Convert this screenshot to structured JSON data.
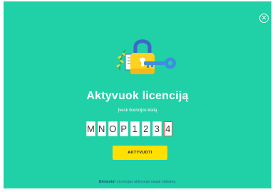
{
  "dialog": {
    "close_symbol": "✕",
    "title": "Aktyvuok licenciją",
    "input_label": "Įvesk licencijos kodą",
    "code_chars": [
      "M",
      "N",
      "O",
      "P",
      "1",
      "2",
      "3",
      "4"
    ],
    "activate_label": "AKTYVUOTI",
    "footer_link": "Dėmesio!",
    "footer_text": "Licencijas aktyvuoja naujai vaikams."
  },
  "icons": [
    "close-icon",
    "lock-icon",
    "key-icon",
    "leaf-icon",
    "notebook-icon"
  ],
  "colors": {
    "background": "#20d0a6",
    "button": "#ffe000",
    "lock_body": "#ffd21f",
    "lock_shackle": "#3d68c9",
    "key": "#3f8de0"
  }
}
